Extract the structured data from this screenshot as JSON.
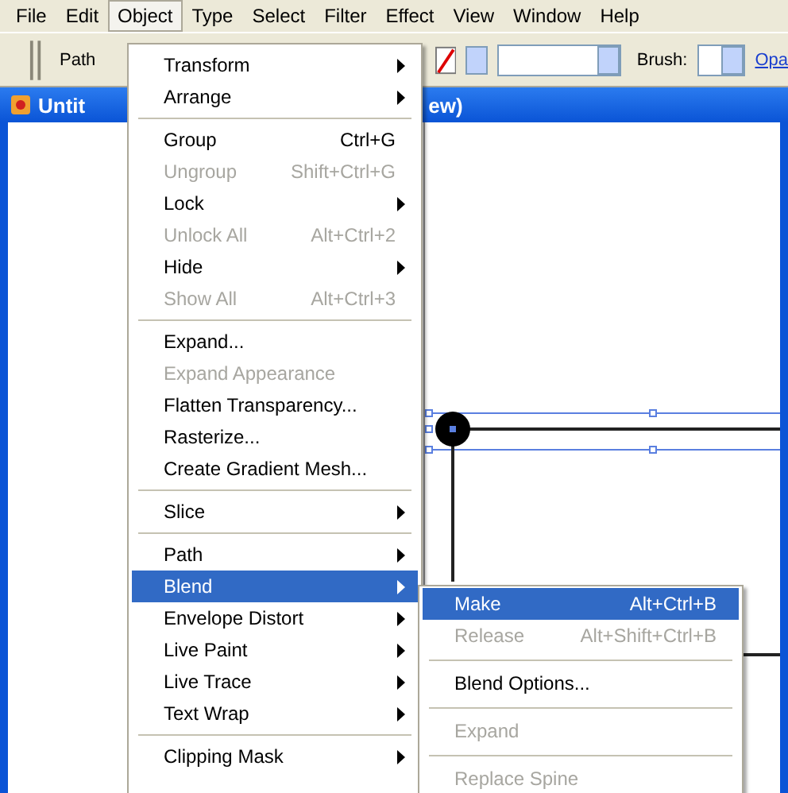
{
  "menu_bar": [
    {
      "label": "File",
      "selected": false
    },
    {
      "label": "Edit",
      "selected": false
    },
    {
      "label": "Object",
      "selected": true
    },
    {
      "label": "Type",
      "selected": false
    },
    {
      "label": "Select",
      "selected": false
    },
    {
      "label": "Filter",
      "selected": false
    },
    {
      "label": "Effect",
      "selected": false
    },
    {
      "label": "View",
      "selected": false
    },
    {
      "label": "Window",
      "selected": false
    },
    {
      "label": "Help",
      "selected": false
    }
  ],
  "toolbar": {
    "path_label": "Path",
    "brush_label": "Brush:",
    "opacity_link": "Opa"
  },
  "document": {
    "title_left": "Untit",
    "title_right": "ew)"
  },
  "object_menu": {
    "items": [
      {
        "kind": "item",
        "label": "Transform",
        "submenu": true,
        "disabled": false,
        "selected": false
      },
      {
        "kind": "item",
        "label": "Arrange",
        "submenu": true,
        "disabled": false,
        "selected": false
      },
      {
        "kind": "separator"
      },
      {
        "kind": "item",
        "label": "Group",
        "shortcut": "Ctrl+G",
        "submenu": false,
        "disabled": false,
        "selected": false
      },
      {
        "kind": "item",
        "label": "Ungroup",
        "shortcut": "Shift+Ctrl+G",
        "submenu": false,
        "disabled": true,
        "selected": false
      },
      {
        "kind": "item",
        "label": "Lock",
        "submenu": true,
        "disabled": false,
        "selected": false
      },
      {
        "kind": "item",
        "label": "Unlock All",
        "shortcut": "Alt+Ctrl+2",
        "submenu": false,
        "disabled": true,
        "selected": false
      },
      {
        "kind": "item",
        "label": "Hide",
        "submenu": true,
        "disabled": false,
        "selected": false
      },
      {
        "kind": "item",
        "label": "Show All",
        "shortcut": "Alt+Ctrl+3",
        "submenu": false,
        "disabled": true,
        "selected": false
      },
      {
        "kind": "separator"
      },
      {
        "kind": "item",
        "label": "Expand...",
        "submenu": false,
        "disabled": false,
        "selected": false
      },
      {
        "kind": "item",
        "label": "Expand Appearance",
        "submenu": false,
        "disabled": true,
        "selected": false
      },
      {
        "kind": "item",
        "label": "Flatten Transparency...",
        "submenu": false,
        "disabled": false,
        "selected": false
      },
      {
        "kind": "item",
        "label": "Rasterize...",
        "submenu": false,
        "disabled": false,
        "selected": false
      },
      {
        "kind": "item",
        "label": "Create Gradient Mesh...",
        "submenu": false,
        "disabled": false,
        "selected": false
      },
      {
        "kind": "separator"
      },
      {
        "kind": "item",
        "label": "Slice",
        "submenu": true,
        "disabled": false,
        "selected": false
      },
      {
        "kind": "separator"
      },
      {
        "kind": "item",
        "label": "Path",
        "submenu": true,
        "disabled": false,
        "selected": false
      },
      {
        "kind": "item",
        "label": "Blend",
        "submenu": true,
        "disabled": false,
        "selected": true
      },
      {
        "kind": "item",
        "label": "Envelope Distort",
        "submenu": true,
        "disabled": false,
        "selected": false
      },
      {
        "kind": "item",
        "label": "Live Paint",
        "submenu": true,
        "disabled": false,
        "selected": false
      },
      {
        "kind": "item",
        "label": "Live Trace",
        "submenu": true,
        "disabled": false,
        "selected": false
      },
      {
        "kind": "item",
        "label": "Text Wrap",
        "submenu": true,
        "disabled": false,
        "selected": false
      },
      {
        "kind": "separator"
      },
      {
        "kind": "item",
        "label": "Clipping Mask",
        "submenu": true,
        "disabled": false,
        "selected": false
      }
    ]
  },
  "blend_submenu": {
    "items": [
      {
        "kind": "item",
        "label": "Make",
        "shortcut": "Alt+Ctrl+B",
        "submenu": false,
        "disabled": false,
        "selected": true
      },
      {
        "kind": "item",
        "label": "Release",
        "shortcut": "Alt+Shift+Ctrl+B",
        "submenu": false,
        "disabled": true,
        "selected": false
      },
      {
        "kind": "separator"
      },
      {
        "kind": "item",
        "label": "Blend Options...",
        "submenu": false,
        "disabled": false,
        "selected": false
      },
      {
        "kind": "separator"
      },
      {
        "kind": "item",
        "label": "Expand",
        "submenu": false,
        "disabled": true,
        "selected": false
      },
      {
        "kind": "separator"
      },
      {
        "kind": "item",
        "label": "Replace Spine",
        "submenu": false,
        "disabled": true,
        "selected": false
      }
    ]
  }
}
